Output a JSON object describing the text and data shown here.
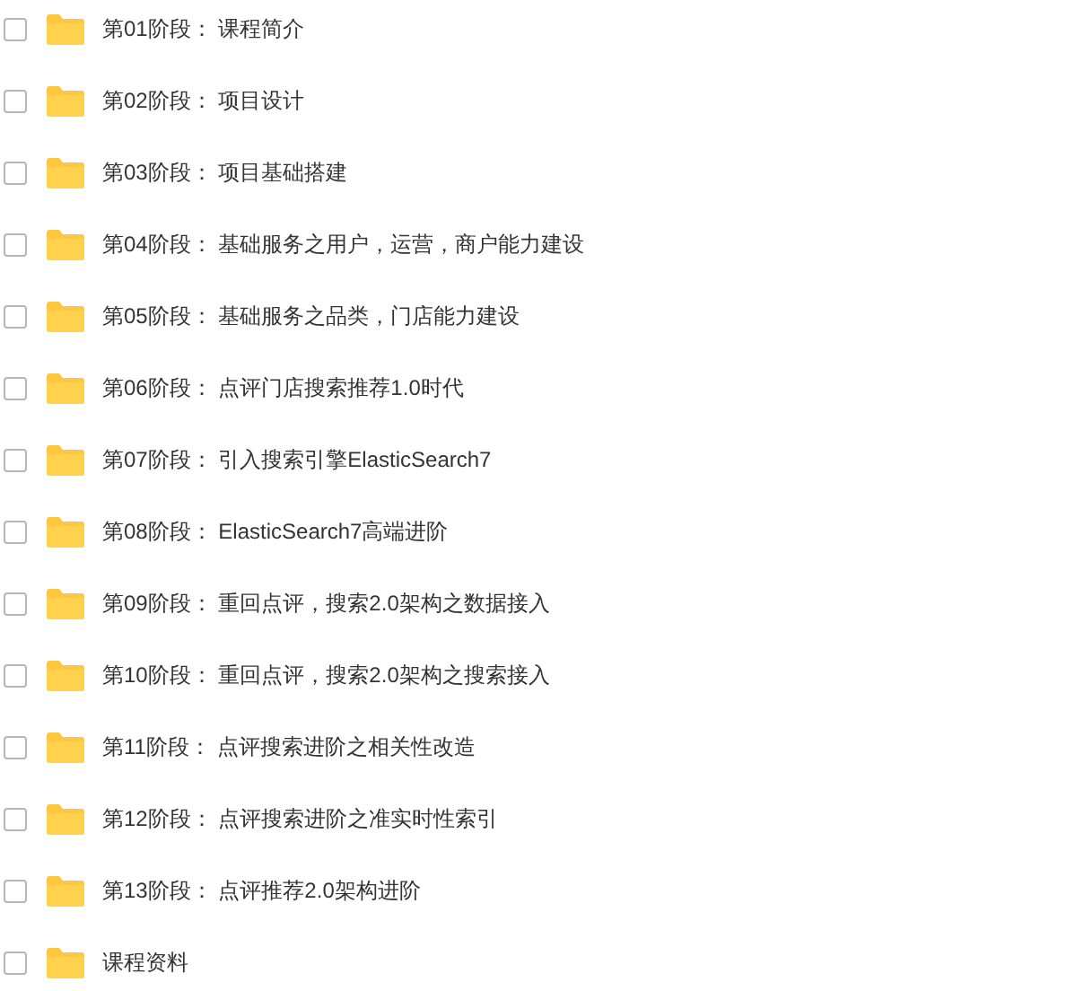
{
  "items": [
    {
      "label": "第01阶段： 课程简介",
      "checked": false
    },
    {
      "label": "第02阶段： 项目设计",
      "checked": false
    },
    {
      "label": "第03阶段： 项目基础搭建",
      "checked": false
    },
    {
      "label": "第04阶段： 基础服务之用户，运营，商户能力建设",
      "checked": false
    },
    {
      "label": "第05阶段： 基础服务之品类，门店能力建设",
      "checked": false
    },
    {
      "label": "第06阶段： 点评门店搜索推荐1.0时代",
      "checked": false
    },
    {
      "label": "第07阶段： 引入搜索引擎ElasticSearch7",
      "checked": false
    },
    {
      "label": "第08阶段： ElasticSearch7高端进阶",
      "checked": false
    },
    {
      "label": "第09阶段： 重回点评，搜索2.0架构之数据接入",
      "checked": false
    },
    {
      "label": "第10阶段： 重回点评，搜索2.0架构之搜索接入",
      "checked": false
    },
    {
      "label": "第11阶段： 点评搜索进阶之相关性改造",
      "checked": false
    },
    {
      "label": "第12阶段： 点评搜索进阶之准实时性索引",
      "checked": false
    },
    {
      "label": "第13阶段： 点评推荐2.0架构进阶",
      "checked": false
    },
    {
      "label": "课程资料",
      "checked": false
    }
  ]
}
